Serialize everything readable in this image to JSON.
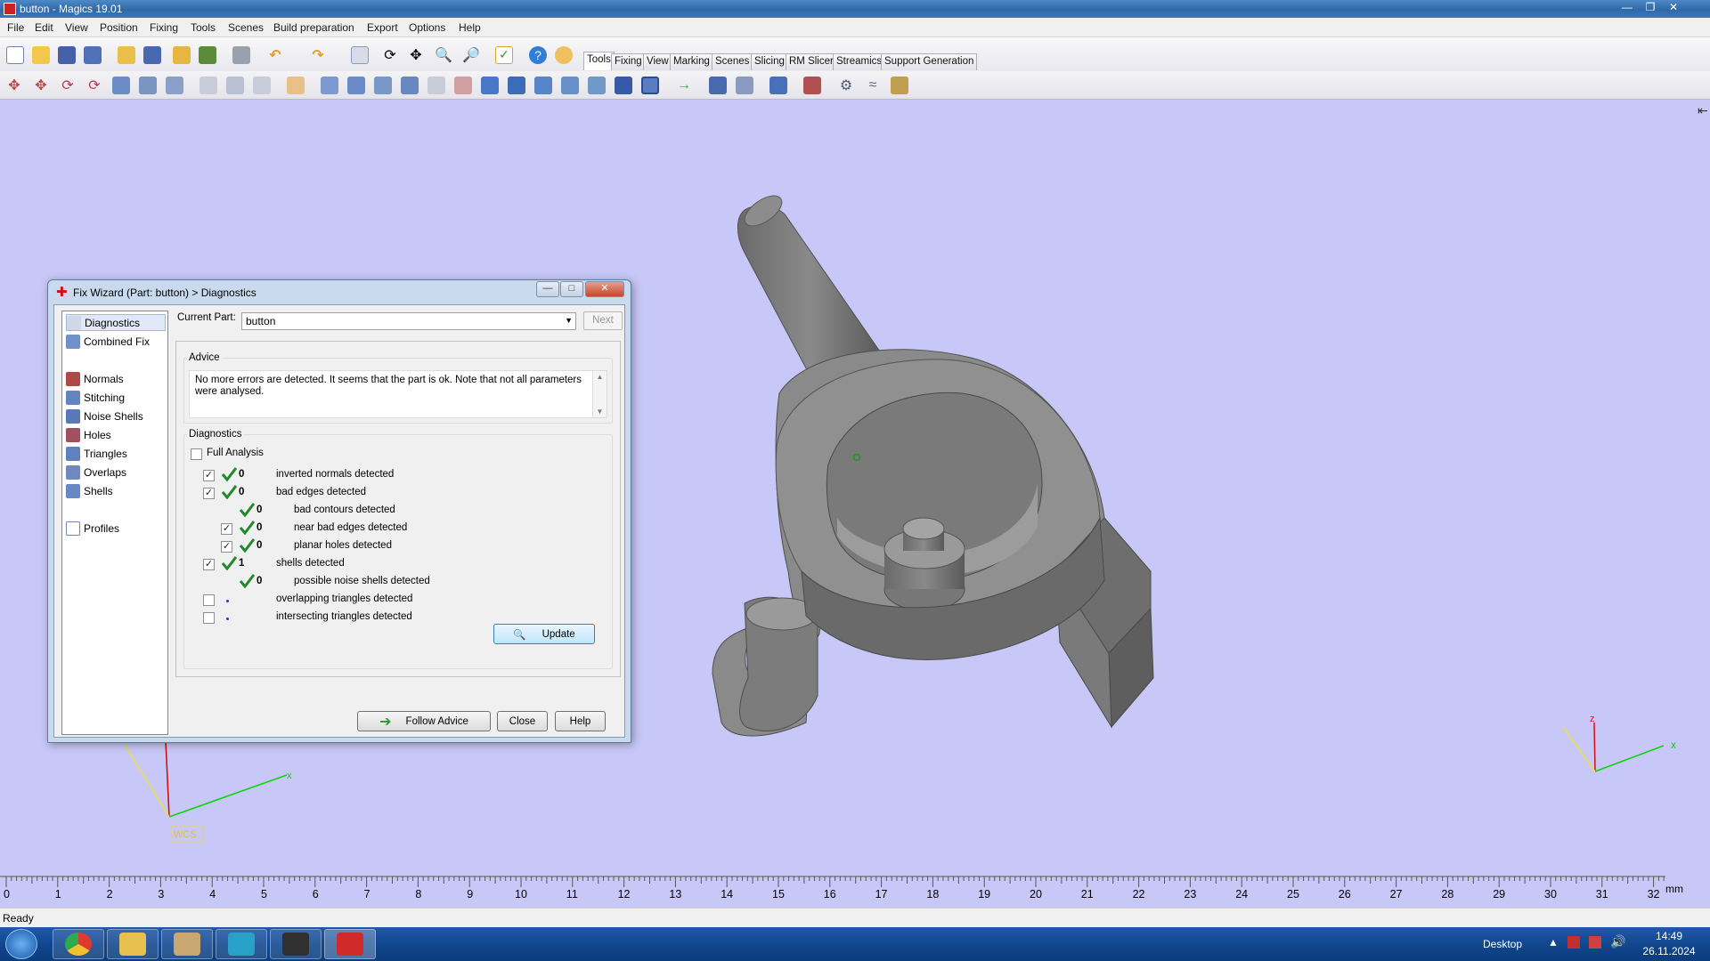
{
  "window": {
    "title": "button - Magics 19.01"
  },
  "menubar": [
    "File",
    "Edit",
    "View",
    "Position",
    "Fixing",
    "Tools",
    "Scenes",
    "Build preparation",
    "Export",
    "Options",
    "Help"
  ],
  "tabs": [
    "Tools",
    "Fixing",
    "View",
    "Marking",
    "Scenes",
    "Slicing",
    "RM Slicer",
    "Streamics",
    "Support Generation"
  ],
  "active_tab": "Tools",
  "viewport": {
    "wcs_label": "WCS",
    "axis_x": "x",
    "axis_z": "z",
    "bg_color": "#c8c8f8"
  },
  "ruler": {
    "ticks": [
      "0",
      "1",
      "2",
      "3",
      "4",
      "5",
      "6",
      "7",
      "8",
      "9",
      "10",
      "11",
      "12",
      "13",
      "14",
      "15",
      "16",
      "17",
      "18",
      "19",
      "20",
      "21",
      "22",
      "23",
      "24",
      "25",
      "26",
      "27",
      "28",
      "29",
      "30",
      "31",
      "32"
    ],
    "unit": "mm"
  },
  "status": "Ready",
  "taskbar": {
    "desktop_label": "Desktop",
    "time": "14:49",
    "date": "26.11.2024"
  },
  "dialog": {
    "title": "Fix Wizard (Part: button) > Diagnostics",
    "nav": [
      "Diagnostics",
      "Combined Fix",
      "Normals",
      "Stitching",
      "Noise Shells",
      "Holes",
      "Triangles",
      "Overlaps",
      "Shells",
      "Profiles"
    ],
    "current_part_label": "Current Part:",
    "current_part_value": "button",
    "next_button": "Next",
    "advice_label": "Advice",
    "advice_text": "No more errors are detected. It seems that the part is ok. Note that not all parameters were analysed.",
    "diagnostics_label": "Diagnostics",
    "full_analysis": "Full Analysis",
    "rows": [
      {
        "indent": 0,
        "checkbox": true,
        "checked": true,
        "status": "ok",
        "count": "0",
        "text": "inverted normals detected"
      },
      {
        "indent": 0,
        "checkbox": true,
        "checked": true,
        "status": "ok",
        "count": "0",
        "text": "bad edges detected"
      },
      {
        "indent": 1,
        "checkbox": false,
        "checked": false,
        "status": "ok",
        "count": "0",
        "text": "bad contours detected"
      },
      {
        "indent": 1,
        "checkbox": true,
        "checked": true,
        "status": "ok",
        "count": "0",
        "text": "near bad edges detected"
      },
      {
        "indent": 1,
        "checkbox": true,
        "checked": true,
        "status": "ok",
        "count": "0",
        "text": "planar holes detected"
      },
      {
        "indent": 0,
        "checkbox": true,
        "checked": true,
        "status": "ok",
        "count": "1",
        "text": "shells detected"
      },
      {
        "indent": 1,
        "checkbox": false,
        "checked": false,
        "status": "ok",
        "count": "0",
        "text": "possible noise shells detected"
      },
      {
        "indent": 0,
        "checkbox": true,
        "checked": false,
        "status": "none",
        "count": "",
        "text": "overlapping triangles detected"
      },
      {
        "indent": 0,
        "checkbox": true,
        "checked": false,
        "status": "none",
        "count": "",
        "text": "intersecting triangles detected"
      }
    ],
    "update_button": "Update",
    "follow_advice_button": "Follow Advice",
    "close_button": "Close",
    "help_button": "Help"
  }
}
